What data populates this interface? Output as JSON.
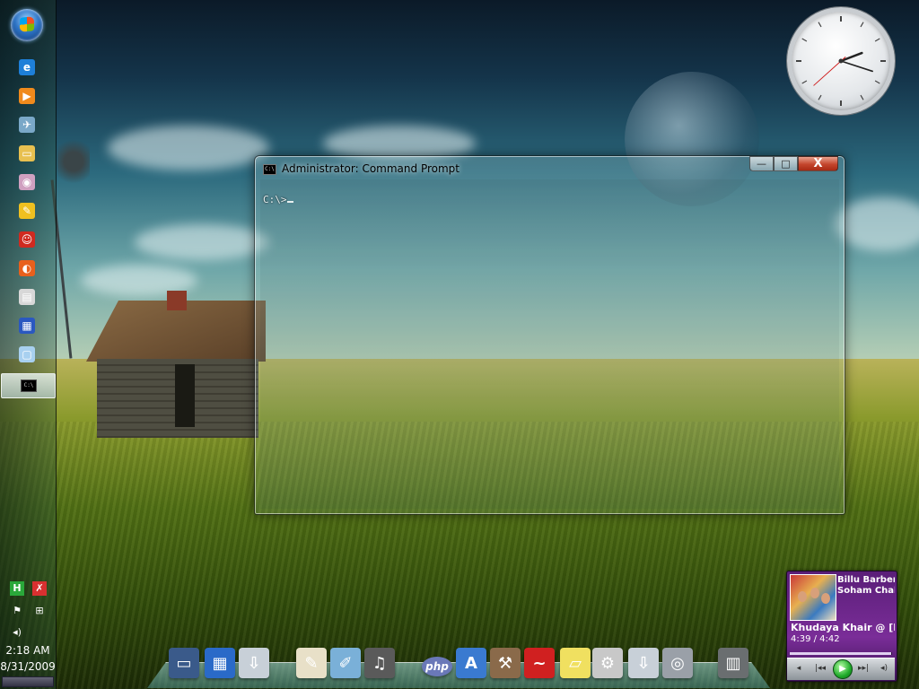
{
  "desktop": {
    "wallpaper": "grassland-barn-moon"
  },
  "sidebar": {
    "start": {
      "icon": "windows-start-orb-icon"
    },
    "pinned": [
      {
        "icon": "internet-explorer-icon",
        "color": "#1e7fd8",
        "glyph": "e"
      },
      {
        "icon": "media-player-icon",
        "color": "#f08a1c",
        "glyph": "▶"
      },
      {
        "icon": "bird-messenger-icon",
        "color": "#7aa8c8",
        "glyph": "✈"
      },
      {
        "icon": "folder-explorer-icon",
        "color": "#e8c050",
        "glyph": "▭"
      },
      {
        "icon": "disc-burner-icon",
        "color": "#d0a0c0",
        "glyph": "◉"
      },
      {
        "icon": "magnifier-paint-icon",
        "color": "#f0c020",
        "glyph": "✎"
      },
      {
        "icon": "yahoo-messenger-icon",
        "color": "#d02a20",
        "glyph": "☺"
      },
      {
        "icon": "firefox-icon",
        "color": "#e8601c",
        "glyph": "◐"
      },
      {
        "icon": "clapperboard-icon",
        "color": "#d8d8d8",
        "glyph": "▤"
      },
      {
        "icon": "notepad-chart-icon",
        "color": "#2a58c0",
        "glyph": "▦"
      },
      {
        "icon": "notepad-icon",
        "color": "#a8d0f0",
        "glyph": "▢"
      }
    ],
    "active_task": {
      "label": "C:\\",
      "icon": "command-prompt-icon"
    },
    "tray": {
      "icons": [
        {
          "icon": "green-h-app-icon",
          "color": "#2aa83a",
          "glyph": "H"
        },
        {
          "icon": "red-tool-icon",
          "color": "#d83030",
          "glyph": "✗"
        },
        {
          "icon": "action-center-flag-icon",
          "color": "#ffffff",
          "glyph": "⚑"
        },
        {
          "icon": "network-icon",
          "color": "#ffffff",
          "glyph": "⊞"
        },
        {
          "icon": "volume-icon",
          "color": "#ffffff",
          "glyph": "◂)"
        }
      ],
      "time": "2:18 AM",
      "date": "8/31/2009"
    }
  },
  "clock_gadget": {
    "hour": 2,
    "minute": 18,
    "second": 38
  },
  "cmd_window": {
    "title": "Administrator: Command Prompt",
    "icon_label": "C:\\",
    "buttons": {
      "minimize": "—",
      "maximize": "□",
      "close": "X"
    },
    "prompt": "C:\\>"
  },
  "dock": {
    "items": [
      {
        "icon": "computer-icon",
        "color": "#3a5a8a",
        "glyph": "▭"
      },
      {
        "icon": "control-panel-icon",
        "color": "#2a6ac8",
        "glyph": "▦"
      },
      {
        "icon": "downloads-drive-icon",
        "color": "#c8d0d8",
        "glyph": "⇩"
      },
      {
        "icon": "documents-icon",
        "color": "#e8e0c8",
        "glyph": "✎"
      },
      {
        "icon": "paint-brush-icon",
        "color": "#7ab0d8",
        "glyph": "✐"
      },
      {
        "icon": "headphones-icon",
        "color": "#5a5a5a",
        "glyph": "♫"
      },
      {
        "icon": "php-icon",
        "color": "#6a78b8",
        "glyph": "php"
      },
      {
        "icon": "app-store-icon",
        "color": "#3a7ad0",
        "glyph": "A"
      },
      {
        "icon": "hammer-icon",
        "color": "#8a6a4a",
        "glyph": "⚒"
      },
      {
        "icon": "chili-pepper-icon",
        "color": "#d02020",
        "glyph": "~"
      },
      {
        "icon": "sticky-notes-icon",
        "color": "#f0e060",
        "glyph": "▱"
      },
      {
        "icon": "wrench-icon",
        "color": "#c8c8c8",
        "glyph": "⚙"
      },
      {
        "icon": "printer-drive-icon",
        "color": "#c8d0d8",
        "glyph": "⇩"
      },
      {
        "icon": "camcorder-icon",
        "color": "#9aa0a8",
        "glyph": "◎"
      },
      {
        "icon": "trash-icon",
        "color": "#6a6e70",
        "glyph": "▥"
      }
    ]
  },
  "media_gadget": {
    "album_art": "film-poster-art",
    "line1": "Billu Barber [...",
    "line2": "Soham Chak...",
    "line3": "Khudaya Khair @ [B...",
    "time": "4:39 / 4:42",
    "progress": 0.99,
    "controls": {
      "prev": "◂",
      "rewind": "|◂◂",
      "play": "▶",
      "forward": "▸▸|",
      "volume": "◂)"
    }
  }
}
